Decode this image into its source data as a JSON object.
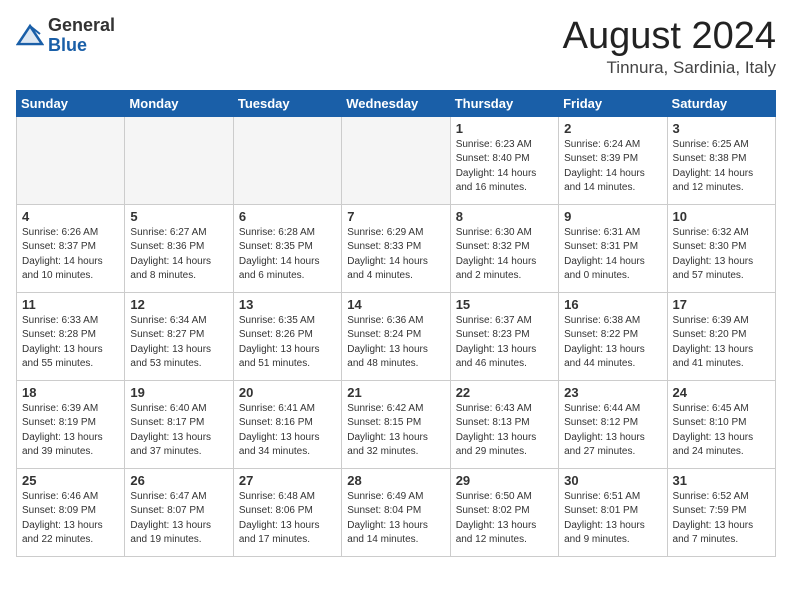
{
  "logo": {
    "general": "General",
    "blue": "Blue"
  },
  "header": {
    "month": "August 2024",
    "location": "Tinnura, Sardinia, Italy"
  },
  "weekdays": [
    "Sunday",
    "Monday",
    "Tuesday",
    "Wednesday",
    "Thursday",
    "Friday",
    "Saturday"
  ],
  "weeks": [
    [
      {
        "day": "",
        "info": ""
      },
      {
        "day": "",
        "info": ""
      },
      {
        "day": "",
        "info": ""
      },
      {
        "day": "",
        "info": ""
      },
      {
        "day": "1",
        "info": "Sunrise: 6:23 AM\nSunset: 8:40 PM\nDaylight: 14 hours\nand 16 minutes."
      },
      {
        "day": "2",
        "info": "Sunrise: 6:24 AM\nSunset: 8:39 PM\nDaylight: 14 hours\nand 14 minutes."
      },
      {
        "day": "3",
        "info": "Sunrise: 6:25 AM\nSunset: 8:38 PM\nDaylight: 14 hours\nand 12 minutes."
      }
    ],
    [
      {
        "day": "4",
        "info": "Sunrise: 6:26 AM\nSunset: 8:37 PM\nDaylight: 14 hours\nand 10 minutes."
      },
      {
        "day": "5",
        "info": "Sunrise: 6:27 AM\nSunset: 8:36 PM\nDaylight: 14 hours\nand 8 minutes."
      },
      {
        "day": "6",
        "info": "Sunrise: 6:28 AM\nSunset: 8:35 PM\nDaylight: 14 hours\nand 6 minutes."
      },
      {
        "day": "7",
        "info": "Sunrise: 6:29 AM\nSunset: 8:33 PM\nDaylight: 14 hours\nand 4 minutes."
      },
      {
        "day": "8",
        "info": "Sunrise: 6:30 AM\nSunset: 8:32 PM\nDaylight: 14 hours\nand 2 minutes."
      },
      {
        "day": "9",
        "info": "Sunrise: 6:31 AM\nSunset: 8:31 PM\nDaylight: 14 hours\nand 0 minutes."
      },
      {
        "day": "10",
        "info": "Sunrise: 6:32 AM\nSunset: 8:30 PM\nDaylight: 13 hours\nand 57 minutes."
      }
    ],
    [
      {
        "day": "11",
        "info": "Sunrise: 6:33 AM\nSunset: 8:28 PM\nDaylight: 13 hours\nand 55 minutes."
      },
      {
        "day": "12",
        "info": "Sunrise: 6:34 AM\nSunset: 8:27 PM\nDaylight: 13 hours\nand 53 minutes."
      },
      {
        "day": "13",
        "info": "Sunrise: 6:35 AM\nSunset: 8:26 PM\nDaylight: 13 hours\nand 51 minutes."
      },
      {
        "day": "14",
        "info": "Sunrise: 6:36 AM\nSunset: 8:24 PM\nDaylight: 13 hours\nand 48 minutes."
      },
      {
        "day": "15",
        "info": "Sunrise: 6:37 AM\nSunset: 8:23 PM\nDaylight: 13 hours\nand 46 minutes."
      },
      {
        "day": "16",
        "info": "Sunrise: 6:38 AM\nSunset: 8:22 PM\nDaylight: 13 hours\nand 44 minutes."
      },
      {
        "day": "17",
        "info": "Sunrise: 6:39 AM\nSunset: 8:20 PM\nDaylight: 13 hours\nand 41 minutes."
      }
    ],
    [
      {
        "day": "18",
        "info": "Sunrise: 6:39 AM\nSunset: 8:19 PM\nDaylight: 13 hours\nand 39 minutes."
      },
      {
        "day": "19",
        "info": "Sunrise: 6:40 AM\nSunset: 8:17 PM\nDaylight: 13 hours\nand 37 minutes."
      },
      {
        "day": "20",
        "info": "Sunrise: 6:41 AM\nSunset: 8:16 PM\nDaylight: 13 hours\nand 34 minutes."
      },
      {
        "day": "21",
        "info": "Sunrise: 6:42 AM\nSunset: 8:15 PM\nDaylight: 13 hours\nand 32 minutes."
      },
      {
        "day": "22",
        "info": "Sunrise: 6:43 AM\nSunset: 8:13 PM\nDaylight: 13 hours\nand 29 minutes."
      },
      {
        "day": "23",
        "info": "Sunrise: 6:44 AM\nSunset: 8:12 PM\nDaylight: 13 hours\nand 27 minutes."
      },
      {
        "day": "24",
        "info": "Sunrise: 6:45 AM\nSunset: 8:10 PM\nDaylight: 13 hours\nand 24 minutes."
      }
    ],
    [
      {
        "day": "25",
        "info": "Sunrise: 6:46 AM\nSunset: 8:09 PM\nDaylight: 13 hours\nand 22 minutes."
      },
      {
        "day": "26",
        "info": "Sunrise: 6:47 AM\nSunset: 8:07 PM\nDaylight: 13 hours\nand 19 minutes."
      },
      {
        "day": "27",
        "info": "Sunrise: 6:48 AM\nSunset: 8:06 PM\nDaylight: 13 hours\nand 17 minutes."
      },
      {
        "day": "28",
        "info": "Sunrise: 6:49 AM\nSunset: 8:04 PM\nDaylight: 13 hours\nand 14 minutes."
      },
      {
        "day": "29",
        "info": "Sunrise: 6:50 AM\nSunset: 8:02 PM\nDaylight: 13 hours\nand 12 minutes."
      },
      {
        "day": "30",
        "info": "Sunrise: 6:51 AM\nSunset: 8:01 PM\nDaylight: 13 hours\nand 9 minutes."
      },
      {
        "day": "31",
        "info": "Sunrise: 6:52 AM\nSunset: 7:59 PM\nDaylight: 13 hours\nand 7 minutes."
      }
    ]
  ]
}
